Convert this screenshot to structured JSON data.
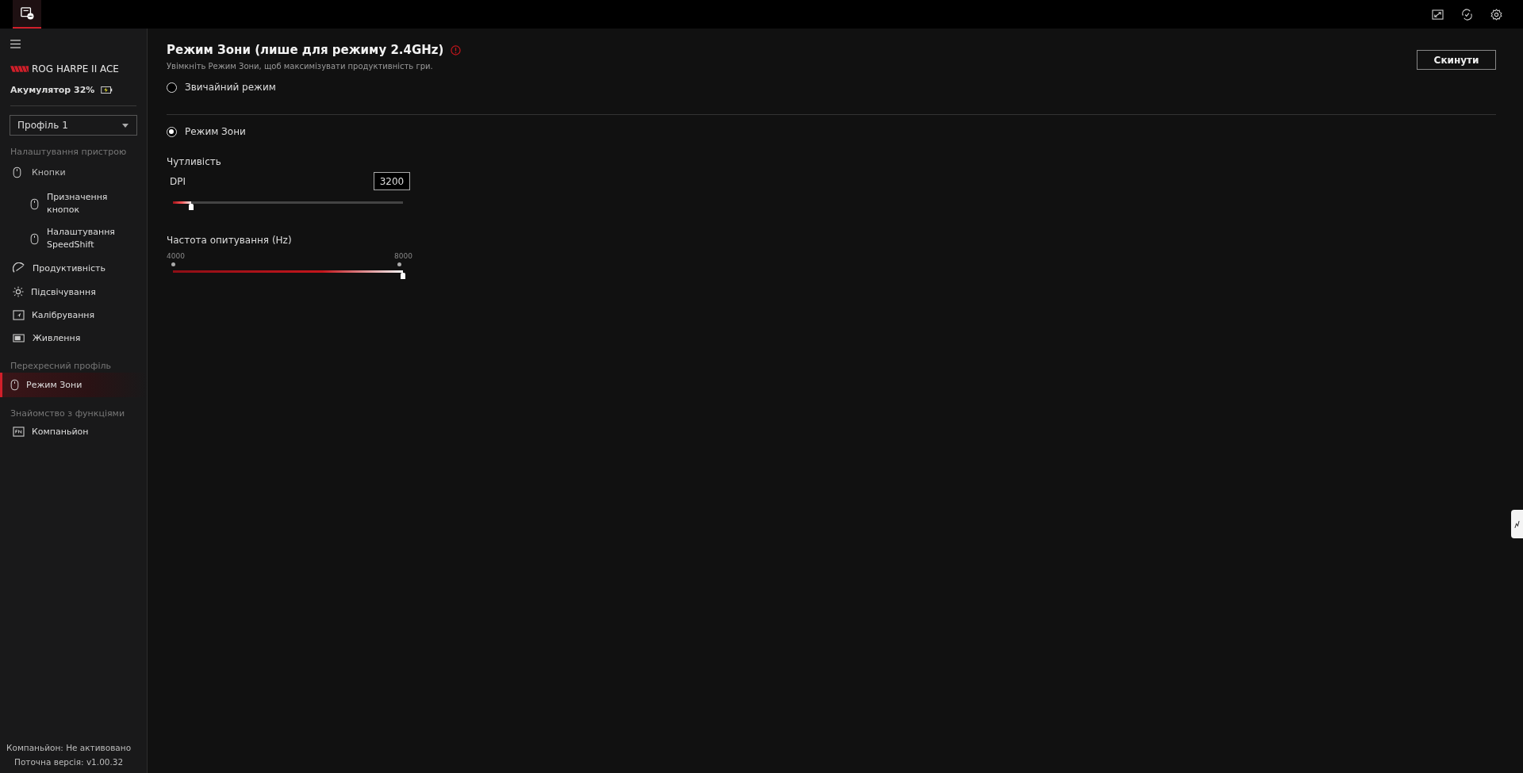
{
  "sidebar": {
    "device_name": "ROG HARPE II ACE",
    "battery": "Акумулятор 32%",
    "profile": "Профіль 1",
    "sections": [
      {
        "title": "Налаштування пристрою",
        "items": [
          {
            "label": "Кнопки",
            "selected": false,
            "children": [
              {
                "label": "Призначення кнопок",
                "selected": false
              },
              {
                "label": "Налаштування SpeedShift",
                "selected": false
              }
            ]
          },
          {
            "label": "Продуктивність",
            "selected": false
          },
          {
            "label": "Підсвічування",
            "selected": false
          },
          {
            "label": "Калібрування",
            "selected": false
          },
          {
            "label": "Живлення",
            "selected": false
          }
        ]
      },
      {
        "title": "Перехресний профіль",
        "items": [
          {
            "label": "Режим Зони",
            "selected": true
          }
        ]
      },
      {
        "title": "Знайомство з функціями",
        "items": [
          {
            "label": "Компаньйон",
            "selected": false
          }
        ]
      }
    ],
    "footer": [
      "Компаньйон: Не активовано",
      "Поточна версія: v1.00.32"
    ]
  },
  "main": {
    "title": "Режим Зони (лише для режиму 2.4GHz)",
    "subtitle": "Увімкніть Режим Зони, щоб максимізувати продуктивність гри.",
    "reset_button": "Скинути",
    "modes": [
      {
        "label": "Звичайний режим",
        "selected": false
      },
      {
        "label": "Режим Зони",
        "selected": true
      }
    ],
    "sensitivity_label": "Чутливість",
    "dpi": {
      "label": "DPI",
      "value": "3200",
      "level": 0.08
    },
    "polling": {
      "label": "Частота опитування (Hz)",
      "min": "4000",
      "max": "8000",
      "level": 1
    }
  }
}
